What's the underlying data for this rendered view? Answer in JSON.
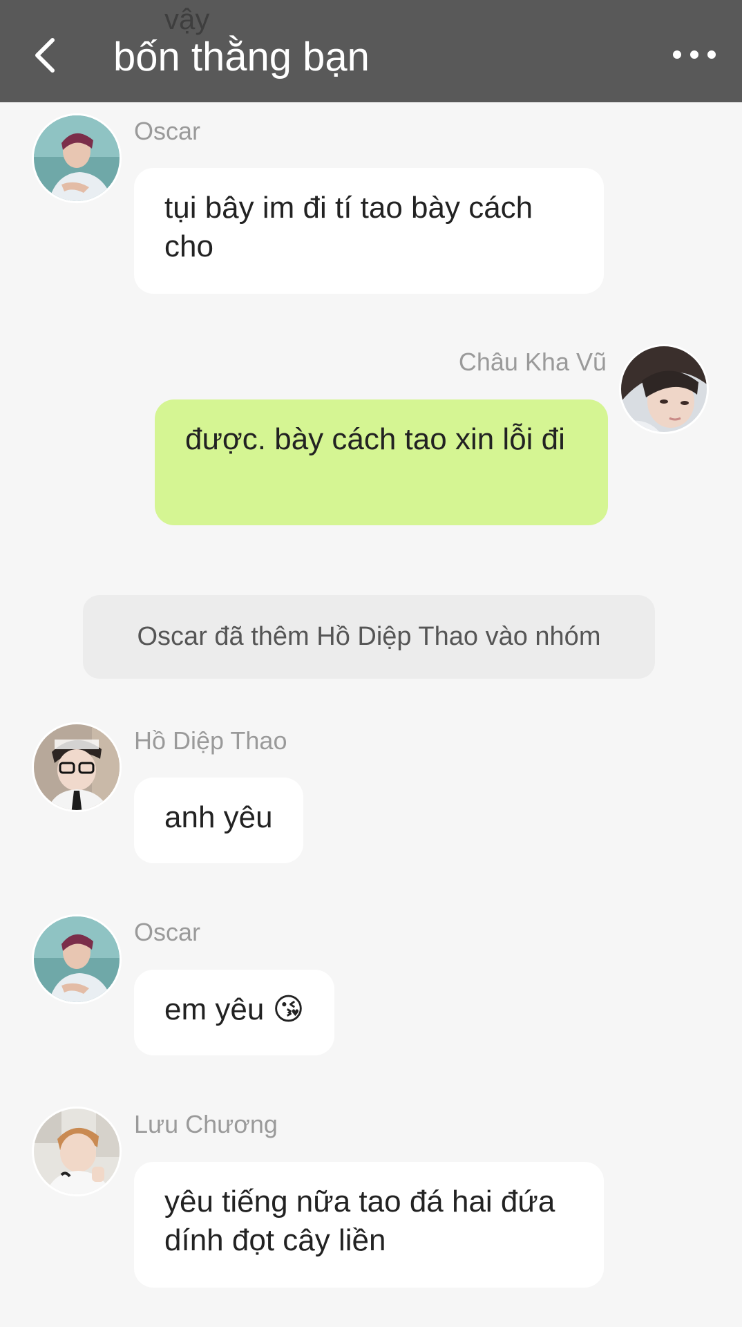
{
  "header": {
    "title": "bốn thằng bạn",
    "scrolled_text": "vậy",
    "back_icon": "chevron-left-icon",
    "more_icon": "more-horizontal-icon",
    "background_color": "#595959"
  },
  "messages": [
    {
      "sender": "Oscar",
      "text": "tụi bây im đi tí tao bày cách cho",
      "mine": false,
      "avatar": "oscar-avatar"
    },
    {
      "sender": "Châu Kha Vũ",
      "text": "được. bày cách tao xin lỗi đi",
      "mine": true,
      "avatar": "chau-kha-vu-avatar"
    },
    {
      "system": "Oscar đã thêm Hồ Diệp Thao vào nhóm"
    },
    {
      "sender": "Hồ Diệp Thao",
      "text": "anh yêu",
      "mine": false,
      "avatar": "ho-diep-thao-avatar"
    },
    {
      "sender": "Oscar",
      "text": "em yêu 😘",
      "mine": false,
      "avatar": "oscar-avatar"
    },
    {
      "sender": "Lưu Chương",
      "text": "yêu tiếng nữa tao đá hai đứa dính đọt cây liền",
      "mine": false,
      "avatar": "luu-chuong-avatar"
    }
  ],
  "colors": {
    "my_bubble": "#d5f593",
    "other_bubble": "#ffffff",
    "background": "#f6f6f6"
  }
}
